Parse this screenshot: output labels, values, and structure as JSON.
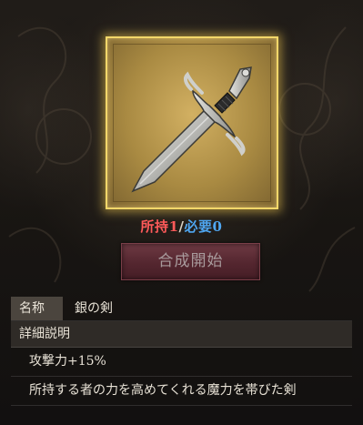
{
  "item": {
    "icon": "silver-sword-icon",
    "owned_label": "所持",
    "owned_count": "1",
    "separator": "/",
    "needed_label": "必要",
    "needed_count": "0"
  },
  "craft_button": {
    "label": "合成開始"
  },
  "info": {
    "name_label": "名称",
    "name_value": "銀の剣",
    "detail_header": "詳細説明",
    "stat": "攻撃力+15%",
    "description": "所持する者の力を高めてくれる魔力を帯びた剣"
  },
  "colors": {
    "frame_gold": "#f3d76a",
    "owned_red": "#ff5a5a",
    "needed_blue": "#4fa6f0",
    "button_maroon": "#5c2a33"
  }
}
